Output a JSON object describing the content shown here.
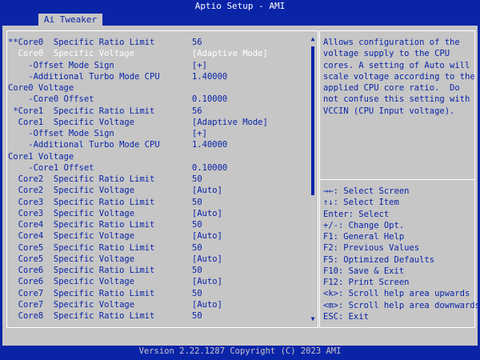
{
  "title": "Aptio Setup - AMI",
  "tab": "Ai Tweaker",
  "rows": [
    {
      "label": "**Core0  Specific Ratio Limit",
      "value": "56"
    },
    {
      "label": "  Core0  Specific Voltage",
      "value": "[Adaptive Mode]",
      "selected": true
    },
    {
      "label": "    -Offset Mode Sign",
      "value": "[+]"
    },
    {
      "label": "    -Additional Turbo Mode CPU",
      "value": "1.40000"
    },
    {
      "label": "Core0 Voltage",
      "value": ""
    },
    {
      "label": "    -Core0 Offset",
      "value": "0.10000"
    },
    {
      "label": " *Core1  Specific Ratio Limit",
      "value": "56"
    },
    {
      "label": "  Core1  Specific Voltage",
      "value": "[Adaptive Mode]"
    },
    {
      "label": "    -Offset Mode Sign",
      "value": "[+]"
    },
    {
      "label": "    -Additional Turbo Mode CPU",
      "value": "1.40000"
    },
    {
      "label": "Core1 Voltage",
      "value": ""
    },
    {
      "label": "    -Core1 Offset",
      "value": "0.10000"
    },
    {
      "label": "  Core2  Specific Ratio Limit",
      "value": "50"
    },
    {
      "label": "  Core2  Specific Voltage",
      "value": "[Auto]"
    },
    {
      "label": "  Core3  Specific Ratio Limit",
      "value": "50"
    },
    {
      "label": "  Core3  Specific Voltage",
      "value": "[Auto]"
    },
    {
      "label": "  Core4  Specific Ratio Limit",
      "value": "50"
    },
    {
      "label": "  Core4  Specific Voltage",
      "value": "[Auto]"
    },
    {
      "label": "  Core5  Specific Ratio Limit",
      "value": "50"
    },
    {
      "label": "  Core5  Specific Voltage",
      "value": "[Auto]"
    },
    {
      "label": "  Core6  Specific Ratio Limit",
      "value": "50"
    },
    {
      "label": "  Core6  Specific Voltage",
      "value": "[Auto]"
    },
    {
      "label": "  Core7  Specific Ratio Limit",
      "value": "50"
    },
    {
      "label": "  Core7  Specific Voltage",
      "value": "[Auto]"
    },
    {
      "label": "  Core8  Specific Ratio Limit",
      "value": "50"
    }
  ],
  "help_lines": [
    "Allows configuration of the",
    "voltage supply to the CPU",
    "cores. A setting of Auto will",
    "scale voltage according to the",
    "applied CPU core ratio.  Do",
    "not confuse this setting with",
    "VCCIN (CPU Input voltage)."
  ],
  "keys": [
    "→←: Select Screen",
    "↑↓: Select Item",
    "Enter: Select",
    "+/-: Change Opt.",
    "F1: General Help",
    "F2: Previous Values",
    "F5: Optimized Defaults",
    "F10: Save & Exit",
    "F12: Print Screen",
    "<k>: Scroll help area upwards",
    "<m>: Scroll help area downwards",
    "ESC: Exit"
  ],
  "footer": "Version 2.22.1287 Copyright (C) 2023 AMI",
  "scroll_up_glyph": "▲",
  "scroll_down_glyph": "▼",
  "colors": {
    "background": "#0a24a8",
    "panel": "#c6c6c6",
    "text": "#0a24a8",
    "selected": "#ffffff"
  }
}
